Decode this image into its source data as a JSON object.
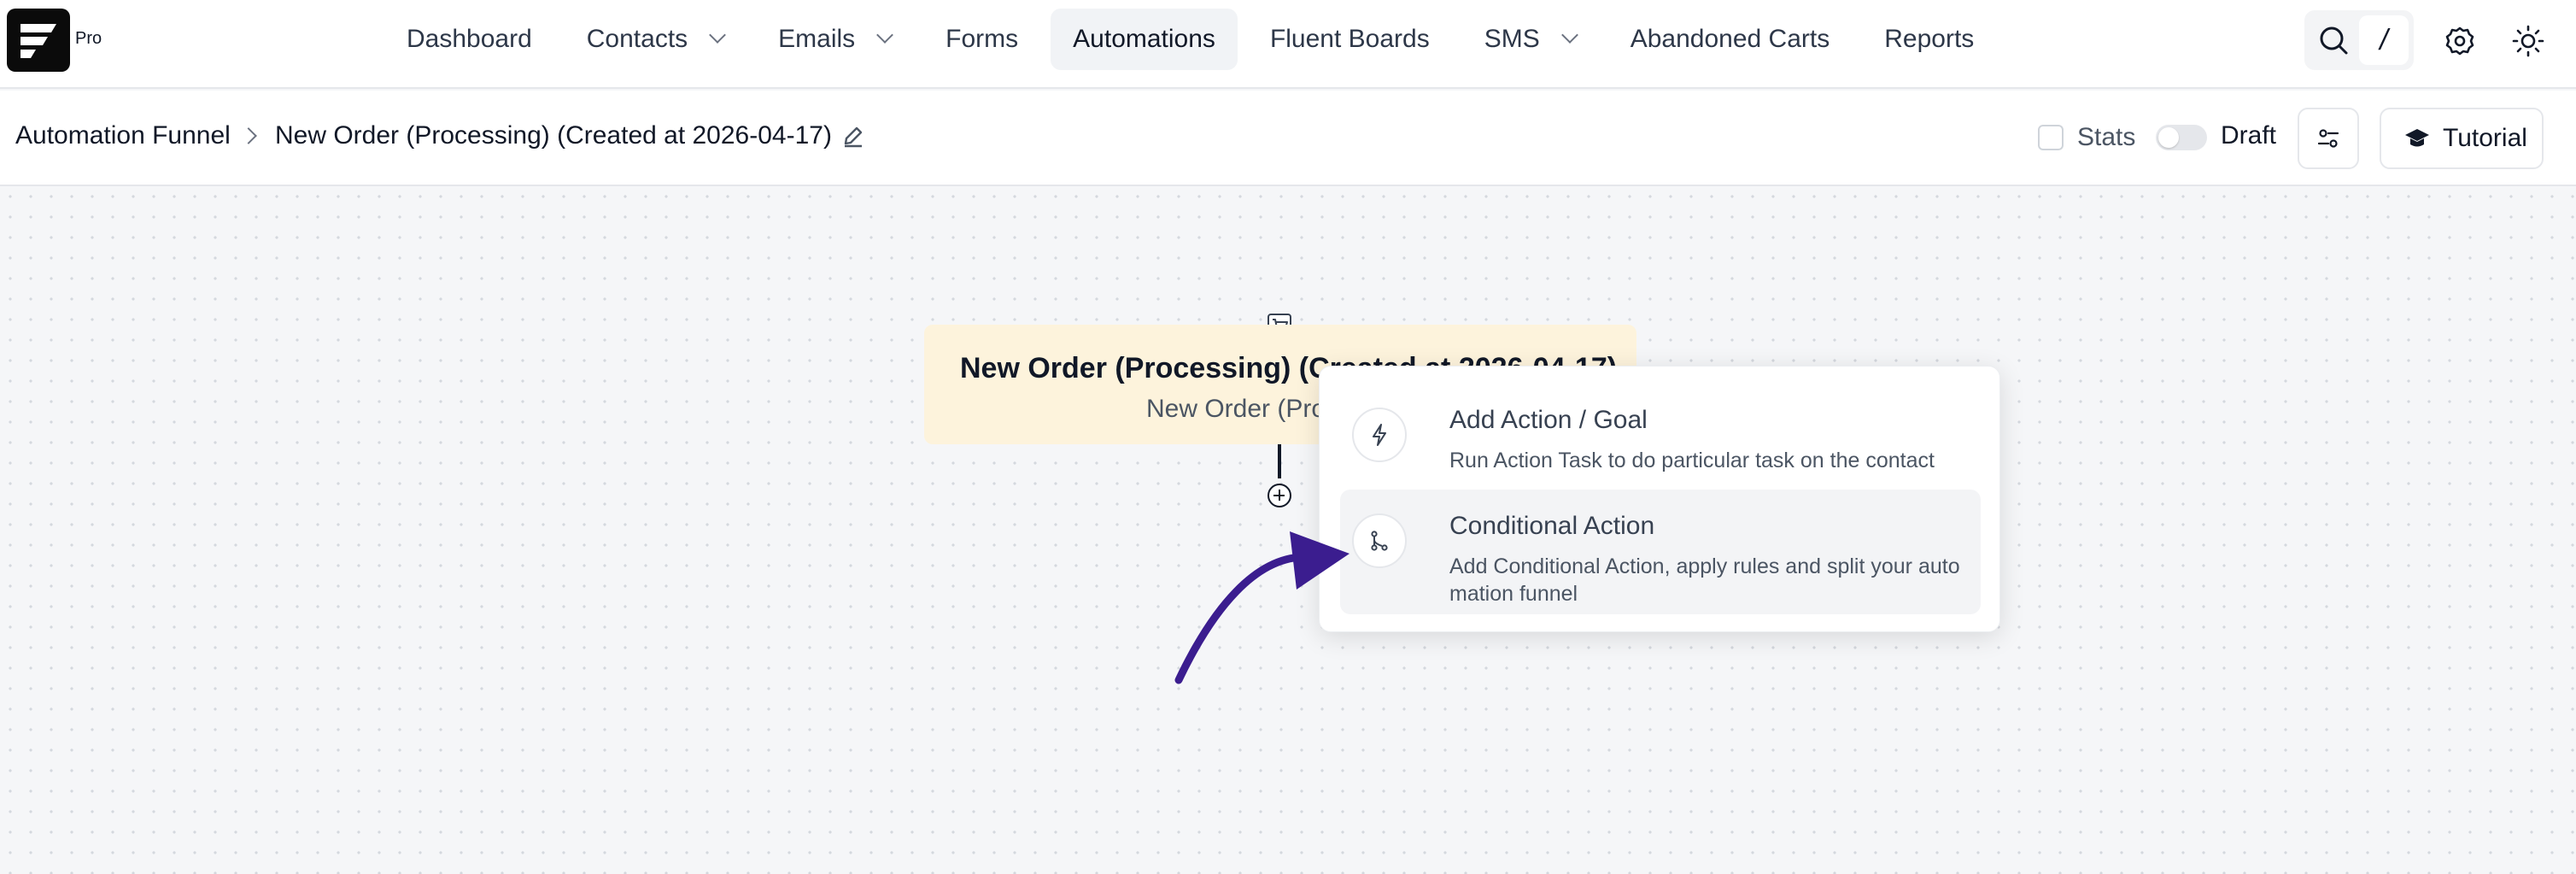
{
  "brand": {
    "badge": "Pro"
  },
  "nav": {
    "items": [
      {
        "label": "Dashboard"
      },
      {
        "label": "Contacts"
      },
      {
        "label": "Emails"
      },
      {
        "label": "Forms"
      },
      {
        "label": "Automations",
        "active": true
      },
      {
        "label": "Fluent Boards"
      },
      {
        "label": "SMS"
      },
      {
        "label": "Abandoned Carts"
      },
      {
        "label": "Reports"
      }
    ],
    "search_shortcut": "/"
  },
  "breadcrumb": {
    "root": "Automation Funnel",
    "current": "New Order (Processing) (Created at 2026-04-17)"
  },
  "toolbar": {
    "stats_label": "Stats",
    "draft_label": "Draft",
    "tutorial_label": "Tutorial"
  },
  "trigger": {
    "title": "New Order (Processing) (Created at 2026-04-17)",
    "subtitle": "New Order (Pro"
  },
  "action_menu": {
    "options": [
      {
        "title": "Add Action / Goal",
        "description": "Run Action Task to do particular task on the contact",
        "icon": "lightning-icon"
      },
      {
        "title": "Conditional Action",
        "description": "Add Conditional Action, apply rules and split your automation funnel",
        "icon": "branch-icon",
        "highlighted": true
      }
    ]
  },
  "colors": {
    "accent_arrow": "#3b1d8f",
    "trigger_card": "#fdf3dc"
  }
}
